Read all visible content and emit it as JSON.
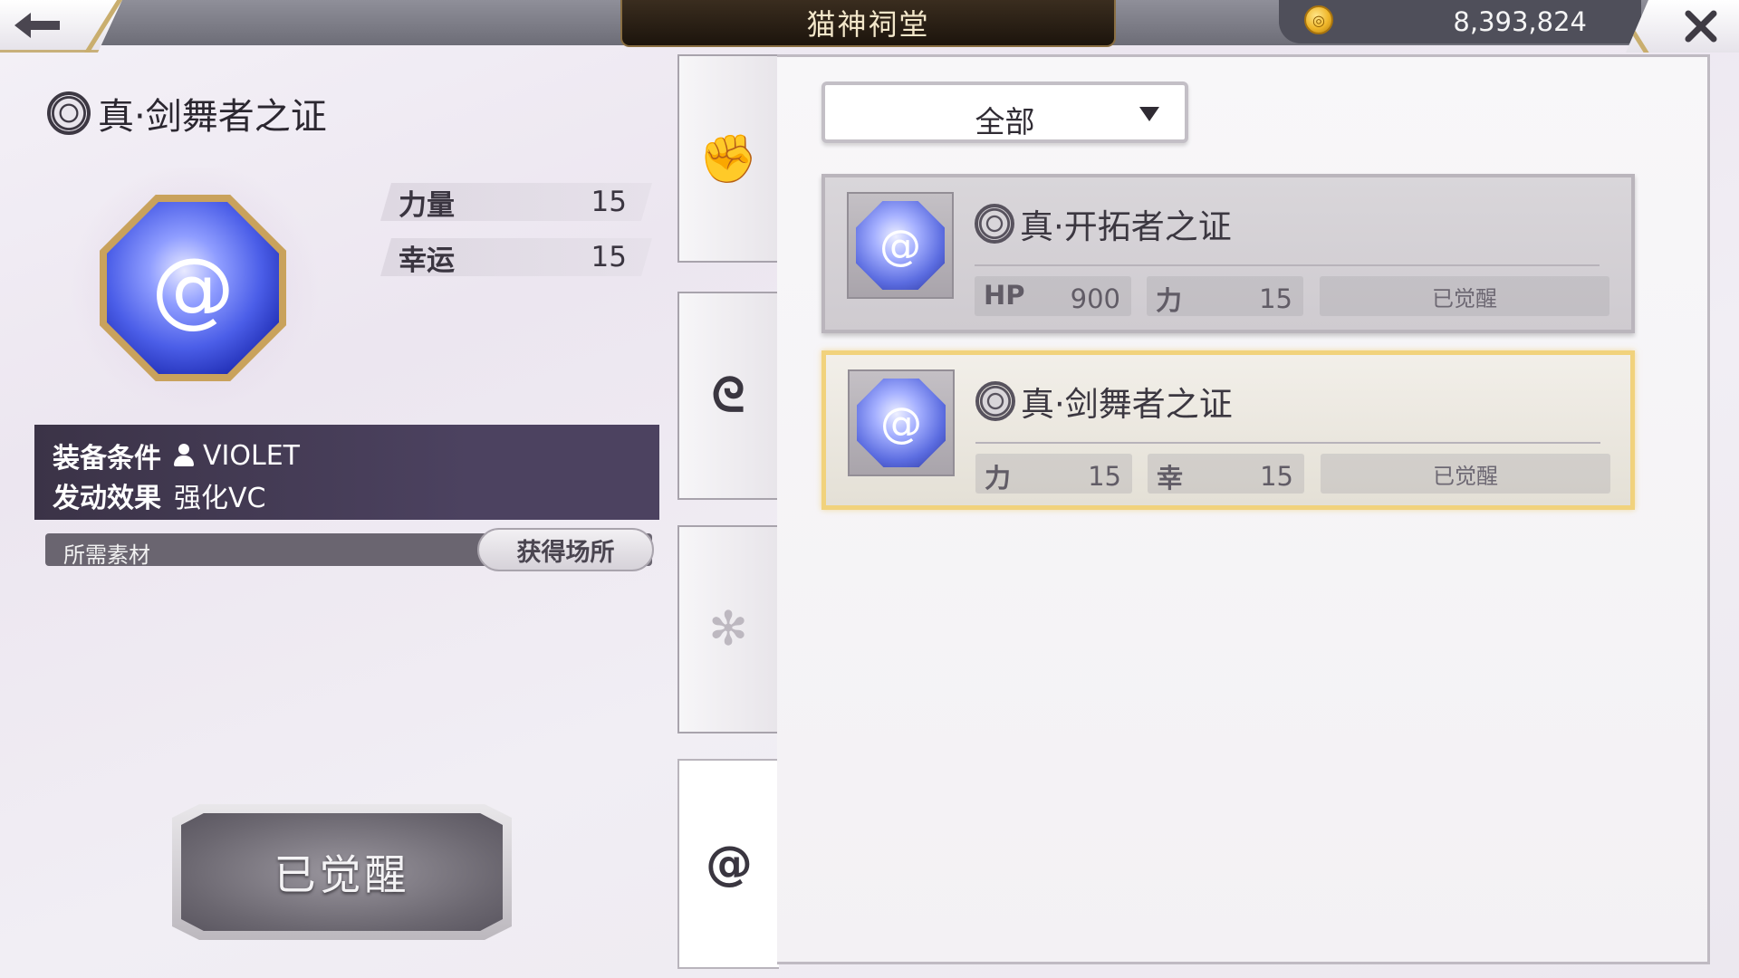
{
  "header": {
    "title": "猫神祠堂",
    "currency": {
      "icon": "coin-icon",
      "value": "8,393,824"
    },
    "back_icon": "back-arrow-icon",
    "close_icon": "close-icon"
  },
  "detail": {
    "title": "真·剑舞者之证",
    "stats": [
      {
        "label": "力量",
        "value": "15"
      },
      {
        "label": "幸运",
        "value": "15"
      }
    ],
    "equip_condition_label": "装备条件",
    "equip_condition_value": "VIOLET",
    "effect_label": "发动效果",
    "effect_value": "强化VC",
    "materials_label": "所需素材",
    "obtain_button": "获得场所",
    "awaken_button": "已觉醒"
  },
  "tabs": [
    {
      "icon": "fist-icon",
      "glyph": "✊"
    },
    {
      "icon": "wind-swirl-icon",
      "glyph": "ᘓ"
    },
    {
      "icon": "emblem-icon",
      "glyph": "✻"
    },
    {
      "icon": "swirl-icon",
      "glyph": "@"
    }
  ],
  "filter": {
    "selected": "全部"
  },
  "cards": [
    {
      "name": "真·开拓者之证",
      "stat1_label": "HP",
      "stat1_value": "900",
      "stat2_label": "力",
      "stat2_value": "15",
      "status": "已觉醒",
      "selected": false
    },
    {
      "name": "真·剑舞者之证",
      "stat1_label": "力",
      "stat1_value": "15",
      "stat2_label": "幸",
      "stat2_value": "15",
      "status": "已觉醒",
      "selected": true
    }
  ],
  "colors": {
    "accent_gold": "#f1d27c",
    "panel_dark": "#3b3347",
    "gem_blue": "#4b5ee8"
  }
}
